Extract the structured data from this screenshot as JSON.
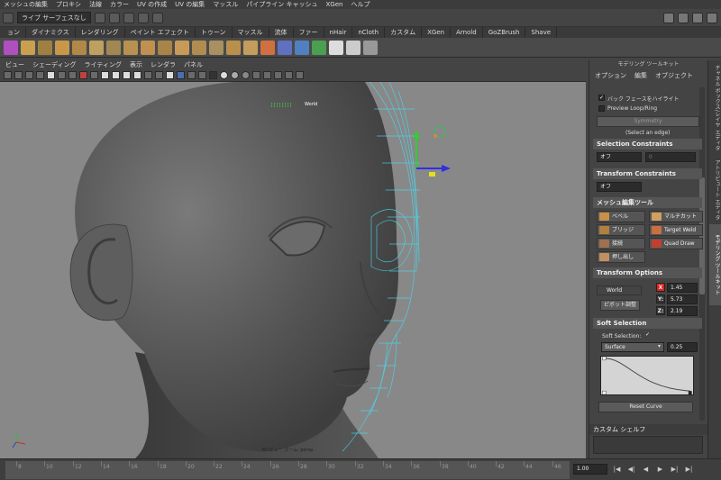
{
  "menu": {
    "items": [
      "メッシュの編集",
      "プロキシ",
      "法線",
      "カラー",
      "UV の作成",
      "UV の編集",
      "マッスル",
      "パイプライン キャッシュ",
      "XGen",
      "ヘルプ"
    ]
  },
  "statusline": {
    "live_surface": "ライブ サーフェスなし"
  },
  "shelf": {
    "tabs": [
      {
        "label": "ョン",
        "active": false
      },
      {
        "label": "ダイナミクス",
        "active": false
      },
      {
        "label": "レンダリング",
        "active": false
      },
      {
        "label": "ペイント エフェクト",
        "active": false
      },
      {
        "label": "トゥーン",
        "active": false
      },
      {
        "label": "マッスル",
        "active": false
      },
      {
        "label": "流体",
        "active": false
      },
      {
        "label": "ファー",
        "active": false
      },
      {
        "label": "nHair",
        "active": false
      },
      {
        "label": "nCloth",
        "active": false
      },
      {
        "label": "カスタム",
        "active": false
      },
      {
        "label": "XGen",
        "active": false
      },
      {
        "label": "Arnold",
        "active": false
      },
      {
        "label": "GoZBrush",
        "active": false
      },
      {
        "label": "Shave",
        "active": false
      }
    ]
  },
  "viewport": {
    "panel_menu": [
      "ビュー",
      "シェーディング",
      "ライティング",
      "表示",
      "レンダラ",
      "パネル"
    ],
    "hud_label": "[][][][]",
    "hud_world": "World",
    "camera_label": "3D ビュー ズーム: persp",
    "background_color": "#888888"
  },
  "timeline": {
    "ticks": [
      "8",
      "10",
      "12",
      "14",
      "16",
      "18",
      "20",
      "22",
      "24",
      "26",
      "28",
      "30",
      "32",
      "34",
      "36",
      "38",
      "40",
      "42",
      "44",
      "46"
    ],
    "visible_labels": [
      "8",
      "24"
    ],
    "current_frame": "1.00",
    "playback": [
      "|◀",
      "◀|",
      "◀",
      "▶",
      "▶|",
      "▶|"
    ]
  },
  "modeling_toolkit": {
    "title": "モデリング ツールキット",
    "menu": [
      "オプション",
      "編集",
      "オブジェクト"
    ],
    "backface_highlight": {
      "label": "バック フェースをハイライト",
      "checked": true
    },
    "preview_loop": {
      "label": "Preview Loop/Ring",
      "checked": false
    },
    "symmetry_button": "Symmetry",
    "select_edge_hint": "(Select an edge)",
    "selection_constraints": {
      "header": "Selection Constraints",
      "value": "オフ",
      "num": "0"
    },
    "transform_constraints": {
      "header": "Transform Constraints",
      "value": "オフ"
    },
    "mesh_tools": {
      "header": "メッシュ編集ツール",
      "buttons": [
        {
          "label": "ベベル",
          "icon": "bevel-icon",
          "color": "#c89048"
        },
        {
          "label": "マルチカット",
          "icon": "multicut-icon",
          "color": "#d0a060"
        },
        {
          "label": "ブリッジ",
          "icon": "bridge-icon",
          "color": "#b08040"
        },
        {
          "label": "Target Weld",
          "icon": "target-weld-icon",
          "color": "#c87040"
        },
        {
          "label": "接続",
          "icon": "connect-icon",
          "color": "#a07050"
        },
        {
          "label": "Quad Draw",
          "icon": "quad-draw-icon",
          "color": "#c04030"
        },
        {
          "label": "押し出し",
          "icon": "extrude-icon",
          "color": "#c09060"
        }
      ]
    },
    "transform_options": {
      "header": "Transform Options",
      "space": "World",
      "pivot_button": "ピボット調整",
      "x": "1.45",
      "y": "5.73",
      "z": "2.19",
      "x_color": "#e02020"
    },
    "soft_selection": {
      "header": "Soft Selection",
      "label": "Soft Selection:",
      "checked": true,
      "falloff": "Surface",
      "radius": "0.25",
      "reset_button": "Reset Curve"
    },
    "custom_shelf": "カスタム シェルフ"
  },
  "side_tabs": [
    "チャネル ボックス/レイヤ エディタ",
    "アトリビュート エディタ",
    "モデリング ツールキット"
  ]
}
